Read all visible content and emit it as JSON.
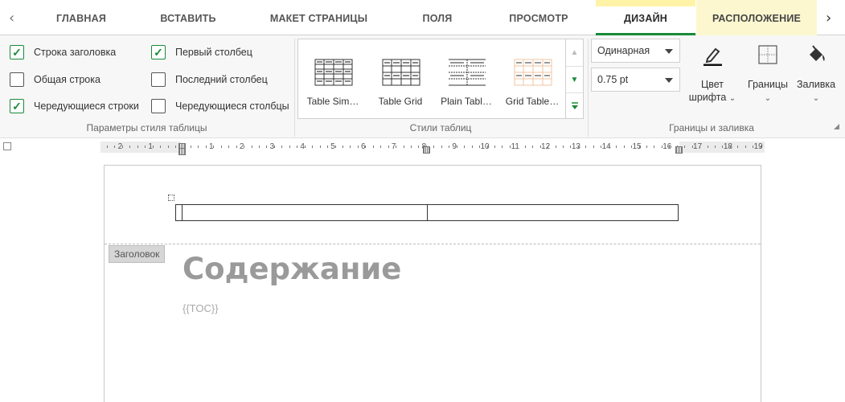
{
  "tabs": {
    "prev_arrow": "‹",
    "next_arrow": "›",
    "items": [
      "ГЛАВНАЯ",
      "ВСТАВИТЬ",
      "МАКЕТ СТРАНИЦЫ",
      "ПОЛЯ",
      "ПРОСМОТР"
    ],
    "active": "ДИЗАЙН",
    "context": "РАСПОЛОЖЕНИЕ"
  },
  "style_options": {
    "label": "Параметры стиля таблицы",
    "header_row": {
      "label": "Строка заголовка",
      "checked": true
    },
    "total_row": {
      "label": "Общая строка",
      "checked": false
    },
    "banded_rows": {
      "label": "Чередующиеся строки",
      "checked": true
    },
    "first_column": {
      "label": "Первый столбец",
      "checked": true
    },
    "last_column": {
      "label": "Последний столбец",
      "checked": false
    },
    "banded_columns": {
      "label": "Чередующиеся столбцы",
      "checked": false
    }
  },
  "table_styles": {
    "label": "Стили таблиц",
    "items": [
      "Table Sim…",
      "Table Grid",
      "Plain Tabl…",
      "Grid Table…"
    ]
  },
  "borders": {
    "label": "Границы и заливка",
    "line_style": "Одинарная",
    "line_width": "0.75 pt",
    "pen_color_label": "Цвет",
    "pen_color_label2": "шрифта",
    "borders_label": "Границы",
    "shading_label": "Заливка",
    "accent_color": "#1a8a3a"
  },
  "ruler": {
    "numbers": [
      "2",
      "1",
      "1",
      "2",
      "3",
      "4",
      "5",
      "6",
      "7",
      "8",
      "9",
      "10",
      "11",
      "12",
      "13",
      "14",
      "15",
      "16",
      "17",
      "18",
      "19"
    ]
  },
  "document": {
    "header_tag": "Заголовок",
    "title": "Содержание",
    "toc": "{{TOC}}"
  }
}
